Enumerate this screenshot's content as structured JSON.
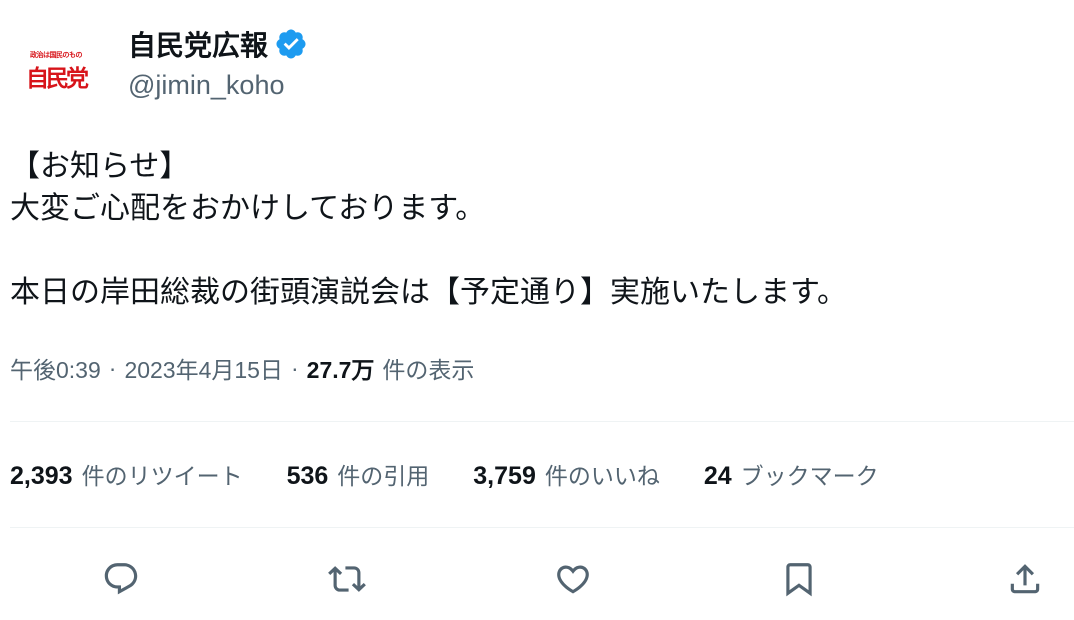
{
  "author": {
    "display_name": "自民党広報",
    "handle": "@jimin_koho",
    "avatar_tagline": "政治は国民のもの",
    "avatar_logo_text": "自民党",
    "verified": true,
    "verified_color": "#1d9bf0"
  },
  "tweet": {
    "lines": [
      "【お知らせ】",
      "大変ご心配をおかけしております。",
      "",
      "本日の岸田総裁の街頭演説会は【予定通り】実施いたします。"
    ]
  },
  "meta": {
    "time": "午後0:39",
    "date": "2023年4月15日",
    "separator": "·",
    "views_count": "27.7万",
    "views_label": "件の表示"
  },
  "stats": [
    {
      "count": "2,393",
      "label": "件のリツイート"
    },
    {
      "count": "536",
      "label": "件の引用"
    },
    {
      "count": "3,759",
      "label": "件のいいね"
    },
    {
      "count": "24",
      "label": "ブックマーク"
    }
  ],
  "actions": [
    {
      "name": "reply",
      "icon": "speech-bubble-icon"
    },
    {
      "name": "retweet",
      "icon": "retweet-arrows-icon"
    },
    {
      "name": "like",
      "icon": "heart-icon"
    },
    {
      "name": "bookmark",
      "icon": "bookmark-icon"
    },
    {
      "name": "share",
      "icon": "share-upload-icon"
    }
  ],
  "colors": {
    "text_primary": "#0f1419",
    "text_secondary": "#536471",
    "divider": "#eff3f4",
    "logo_red": "#d7141a",
    "icon_gray": "#536471"
  }
}
